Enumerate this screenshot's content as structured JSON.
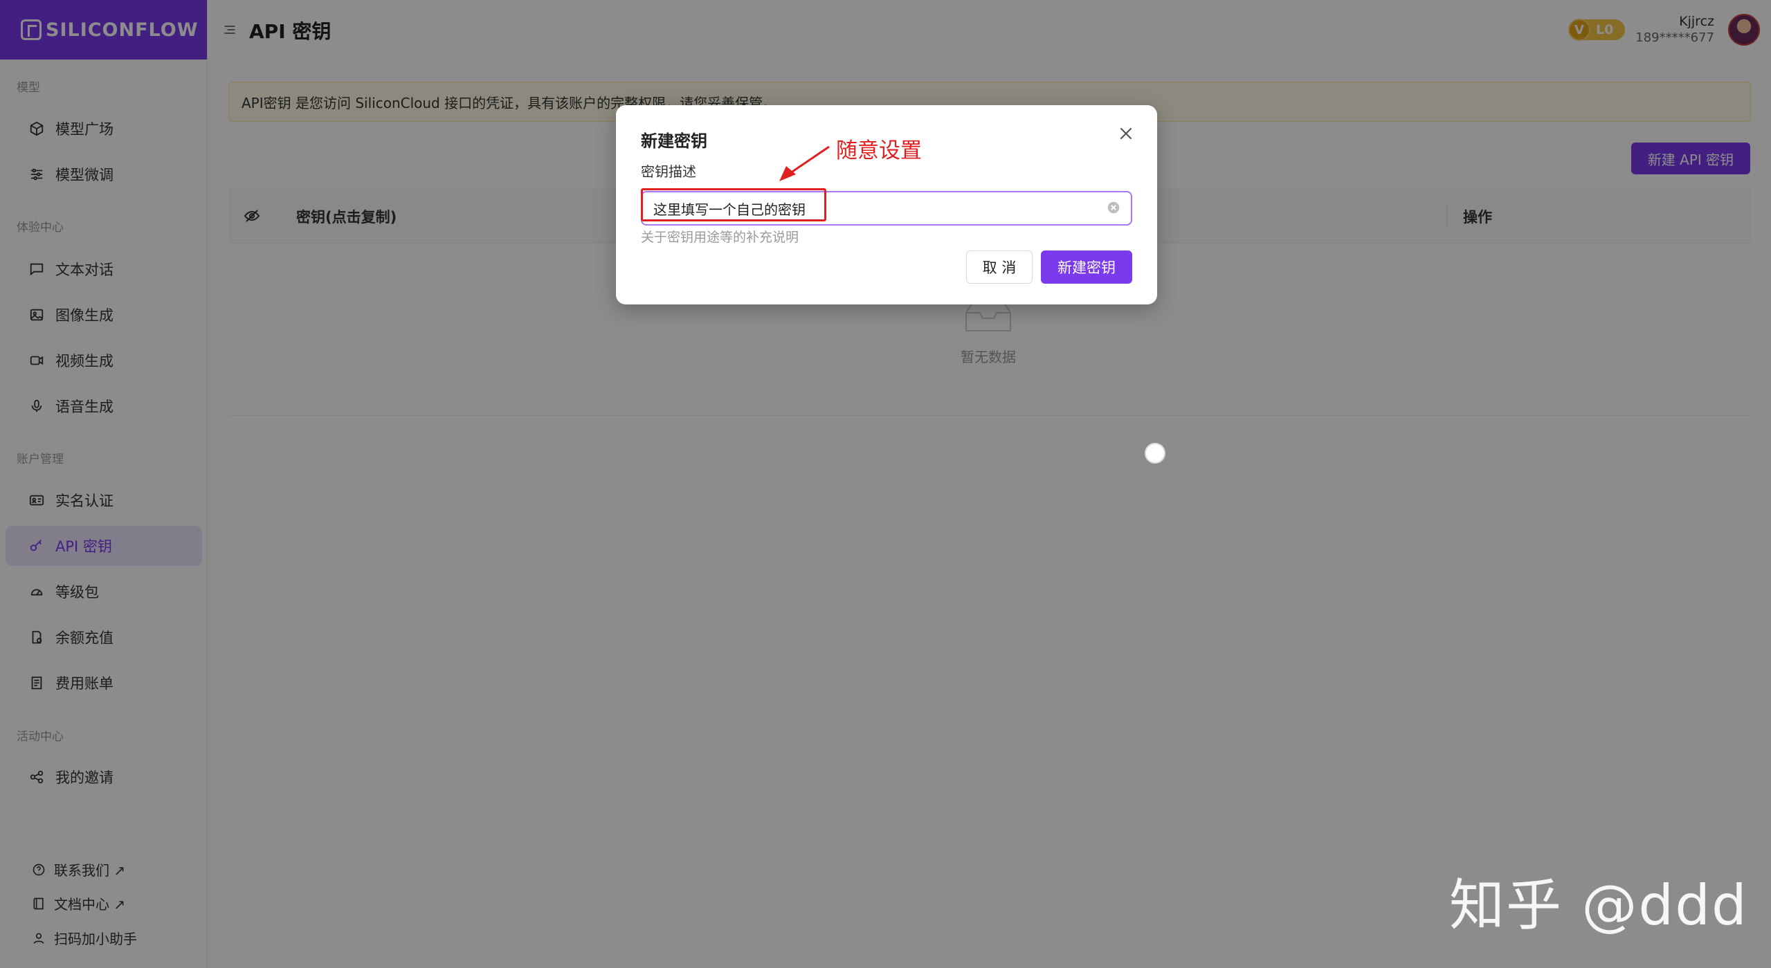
{
  "brand": {
    "name": "SILICONFLOW"
  },
  "header": {
    "title": "API 密钥",
    "level": "L0",
    "level_v": "V",
    "user_name": "Kjjrcz",
    "user_phone": "189*****677"
  },
  "sidebar": {
    "groups": [
      "模型",
      "体验中心",
      "账户管理",
      "活动中心"
    ],
    "items": [
      {
        "label": "模型广场",
        "icon": "cube-icon"
      },
      {
        "label": "模型微调",
        "icon": "sliders-icon"
      },
      {
        "label": "文本对话",
        "icon": "chat-icon"
      },
      {
        "label": "图像生成",
        "icon": "image-icon"
      },
      {
        "label": "视频生成",
        "icon": "video-icon"
      },
      {
        "label": "语音生成",
        "icon": "mic-icon"
      },
      {
        "label": "实名认证",
        "icon": "id-card-icon"
      },
      {
        "label": "API 密钥",
        "icon": "key-icon",
        "active": true
      },
      {
        "label": "等级包",
        "icon": "gauge-icon"
      },
      {
        "label": "余额充值",
        "icon": "recharge-icon"
      },
      {
        "label": "费用账单",
        "icon": "bill-icon"
      },
      {
        "label": "我的邀请",
        "icon": "share-icon"
      }
    ],
    "footer": [
      {
        "label": "联系我们 ↗",
        "icon": "help-icon"
      },
      {
        "label": "文档中心 ↗",
        "icon": "book-icon"
      },
      {
        "label": "扫码加小助手",
        "icon": "user-icon"
      }
    ]
  },
  "main": {
    "notice": "API密钥 是您访问 SiliconCloud 接口的凭证，具有该账户的完整权限，请您妥善保管。",
    "new_button": "新建 API 密钥",
    "table": {
      "col_key": "密钥(点击复制)",
      "col_op": "操作",
      "empty": "暂无数据"
    }
  },
  "modal": {
    "title": "新建密钥",
    "field_label": "密钥描述",
    "field_value": "这里填写一个自己的密钥",
    "field_help": "关于密钥用途等的补充说明",
    "cancel": "取 消",
    "submit": "新建密钥"
  },
  "annotation": {
    "text": "随意设置",
    "color": "#e02020"
  },
  "watermark": "知乎 @ddd",
  "colors": {
    "accent": "#7c3aed",
    "notice_bg": "#fffbe6",
    "badge": "#f5c542"
  }
}
